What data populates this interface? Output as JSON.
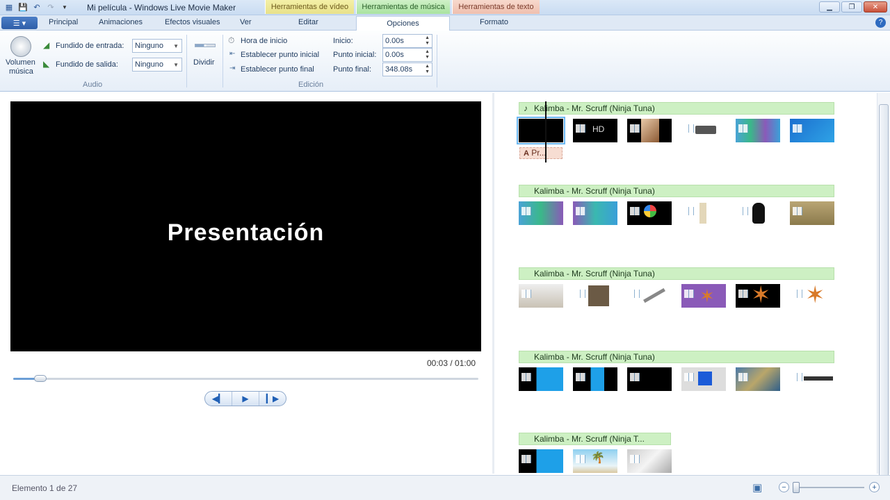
{
  "title_bar": {
    "app_title": "Mi película - Windows Live Movie Maker",
    "context_tabs": {
      "video": "Herramientas de vídeo",
      "music": "Herramientas de música",
      "text": "Herramientas de texto"
    }
  },
  "tabs": {
    "principal": "Principal",
    "animaciones": "Animaciones",
    "efectos": "Efectos visuales",
    "ver": "Ver",
    "editar": "Editar",
    "opciones": "Opciones",
    "formato": "Formato"
  },
  "ribbon": {
    "audio": {
      "volume_label_1": "Volumen",
      "volume_label_2": "música",
      "fade_in_label": "Fundido de entrada:",
      "fade_in_value": "Ninguno",
      "fade_out_label": "Fundido de salida:",
      "fade_out_value": "Ninguno",
      "group": "Audio"
    },
    "edicion": {
      "split": "Dividir",
      "start_time": "Hora de inicio",
      "set_start": "Establecer punto inicial",
      "set_end": "Establecer punto final",
      "inicio_label": "Inicio:",
      "inicio_value": "0.00s",
      "punto_inicial_label": "Punto inicial:",
      "punto_inicial_value": "0.00s",
      "punto_final_label": "Punto final:",
      "punto_final_value": "348.08s",
      "group": "Edición"
    }
  },
  "preview": {
    "caption": "Presentación",
    "time": "00:03 / 01:00",
    "progress": 0.05
  },
  "storyboard": {
    "music_title": "Kalimba - Mr. Scruff (Ninja Tuna)",
    "music_title_short": "Kalimba - Mr. Scruff (Ninja T...",
    "caption_chip": "Pr..."
  },
  "status": {
    "item": "Elemento 1 de 27"
  }
}
